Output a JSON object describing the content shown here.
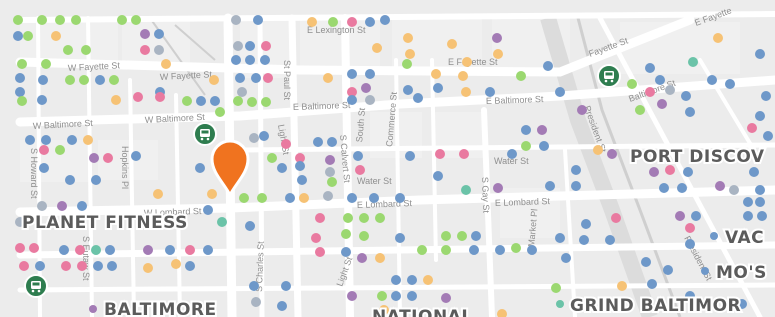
{
  "map": {
    "colors": {
      "background": "#ececec",
      "block": "#f0f0f0",
      "road": "#ffffff",
      "highway": "#dcdcdc",
      "rail": "#cfcfcf",
      "label_text": "#5b5b5b",
      "street_text": "#8f8f8f",
      "transit_badge": "#2e7d4f",
      "selected_pin": "#f0731f",
      "dot_green": "#9bd870",
      "dot_blue": "#6e98c9",
      "dot_orange": "#f6c275",
      "dot_pink": "#e97aa0",
      "dot_purple": "#a37bb5",
      "dot_teal": "#6bc3a8",
      "dot_grey": "#a9b4c2"
    },
    "place_labels": {
      "planet_fitness": "PLANET FITNESS",
      "baltimore": "BALTIMORE",
      "national": "NATIONAL",
      "port_discovery": "PORT DISCOV",
      "grind_baltimore": "GRIND BALTIMOR",
      "vac": "VAC",
      "mos": "MO'S"
    },
    "street_labels": {
      "e_lexington": "E Lexington St",
      "e_fayette_top": "E Fayette",
      "fayette_right": "Fayette St",
      "w_fayette_1": "W Fayette St",
      "w_fayette_2": "W Fayette St",
      "e_fayette": "E Fayette St",
      "baltimore_right": "Baltimore St",
      "e_baltimore_1": "E Baltimore St",
      "e_baltimore_2": "E Baltimore St",
      "w_baltimore_1": "W Baltimore St",
      "w_baltimore_2": "W Baltimore St",
      "st_paul": "St Paul St",
      "light_1": "Light St",
      "light_2": "Light St",
      "s_calvert": "S Calvert St",
      "water_1": "Water St",
      "water_2": "Water St",
      "e_lombard_1": "E Lombard St",
      "e_lombard_2": "E Lombard St",
      "w_lombard": "W Lombard St",
      "s_gay": "S Gay St",
      "president_1": "President St",
      "president_2": "President St",
      "s_howard": "S Howard St",
      "hopkins": "Hopkins Pl",
      "s_eutaw": "S Eutaw St",
      "south": "South St",
      "commerce": "Commerce St",
      "market": "Market Pl",
      "s_charles": "S Charles St"
    },
    "icons": {
      "transit": "bus-icon",
      "selected": "map-pin-icon",
      "poi": "poi-dot-icon"
    }
  }
}
